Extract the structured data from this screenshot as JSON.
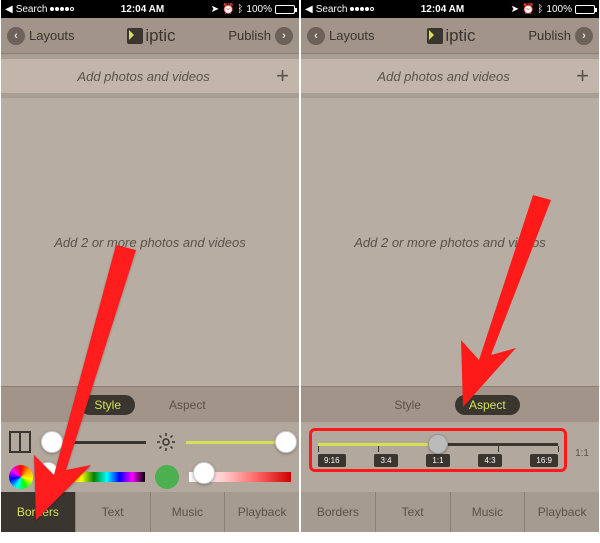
{
  "status": {
    "back_label": "Search",
    "time": "12:04 AM",
    "battery_pct": "100%"
  },
  "nav": {
    "left_label": "Layouts",
    "logo_text": "iptic",
    "right_label": "Publish"
  },
  "top_strip": {
    "prompt": "Add photos and videos"
  },
  "main": {
    "empty_prompt": "Add 2 or more photos and videos"
  },
  "pills": {
    "style": "Style",
    "aspect": "Aspect"
  },
  "aspect_ratios": [
    "9:16",
    "3:4",
    "1:1",
    "4:3",
    "16:9"
  ],
  "aspect_current_label": "1:1",
  "bottom_tabs": [
    "Borders",
    "Text",
    "Music",
    "Playback"
  ]
}
